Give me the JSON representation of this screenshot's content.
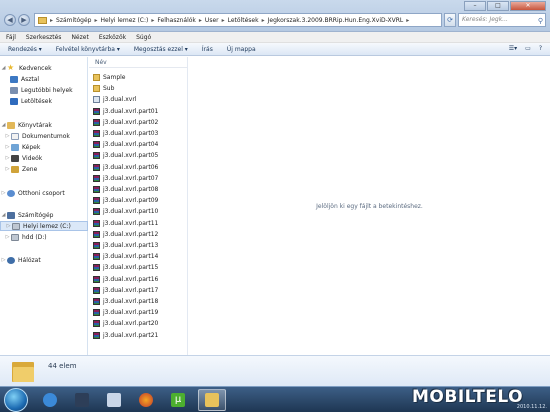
{
  "address_bar": {
    "crumbs": [
      "Számítógép",
      "Helyi lemez (C:)",
      "Felhasználók",
      "User",
      "Letöltések",
      "Jegkorszak.3.2009.BRRip.Hun.Eng.XviD-XVRL"
    ],
    "search_placeholder": "Keresés: Jegk..."
  },
  "menu": [
    "Fájl",
    "Szerkesztés",
    "Nézet",
    "Eszközök",
    "Súgó"
  ],
  "commands": [
    "Rendezés ▾",
    "Felvétel könyvtárba ▾",
    "Megosztás ezzel ▾",
    "Írás",
    "Új mappa"
  ],
  "nav": {
    "favorites": "Kedvencek",
    "desktop": "Asztal",
    "recent": "Legutóbbi helyek",
    "downloads": "Letöltések",
    "libraries": "Könyvtárak",
    "documents": "Dokumentumok",
    "pictures": "Képek",
    "videos": "Videók",
    "music": "Zene",
    "homegroup": "Otthoni csoport",
    "computer": "Számítógép",
    "local_disk": "Helyi lemez (C:)",
    "hdd": "hdd (D:)",
    "network": "Hálózat"
  },
  "column_header": "Név",
  "files": [
    {
      "name": "Sample",
      "type": "folder"
    },
    {
      "name": "Sub",
      "type": "folder"
    },
    {
      "name": "j3.dual.xvrl",
      "type": "xvrl"
    },
    {
      "name": "j3.dual.xvrl.part01",
      "type": "rar"
    },
    {
      "name": "j3.dual.xvrl.part02",
      "type": "rar"
    },
    {
      "name": "j3.dual.xvrl.part03",
      "type": "rar"
    },
    {
      "name": "j3.dual.xvrl.part04",
      "type": "rar"
    },
    {
      "name": "j3.dual.xvrl.part05",
      "type": "rar"
    },
    {
      "name": "j3.dual.xvrl.part06",
      "type": "rar"
    },
    {
      "name": "j3.dual.xvrl.part07",
      "type": "rar"
    },
    {
      "name": "j3.dual.xvrl.part08",
      "type": "rar"
    },
    {
      "name": "j3.dual.xvrl.part09",
      "type": "rar"
    },
    {
      "name": "j3.dual.xvrl.part10",
      "type": "rar"
    },
    {
      "name": "j3.dual.xvrl.part11",
      "type": "rar"
    },
    {
      "name": "j3.dual.xvrl.part12",
      "type": "rar"
    },
    {
      "name": "j3.dual.xvrl.part13",
      "type": "rar"
    },
    {
      "name": "j3.dual.xvrl.part14",
      "type": "rar"
    },
    {
      "name": "j3.dual.xvrl.part15",
      "type": "rar"
    },
    {
      "name": "j3.dual.xvrl.part16",
      "type": "rar"
    },
    {
      "name": "j3.dual.xvrl.part17",
      "type": "rar"
    },
    {
      "name": "j3.dual.xvrl.part18",
      "type": "rar"
    },
    {
      "name": "j3.dual.xvrl.part19",
      "type": "rar"
    },
    {
      "name": "j3.dual.xvrl.part20",
      "type": "rar"
    },
    {
      "name": "j3.dual.xvrl.part21",
      "type": "rar"
    }
  ],
  "preview_message": "Jelöljön ki egy fájlt a betekintéshez.",
  "status": {
    "item_count": "44 elem"
  },
  "taskbar": {
    "brand": "MOBILTELO",
    "date": "2010.11.12."
  },
  "colors": {
    "accent": "#1e395b",
    "selection": "#dbe8f8",
    "taskbar": "#2a4468"
  }
}
